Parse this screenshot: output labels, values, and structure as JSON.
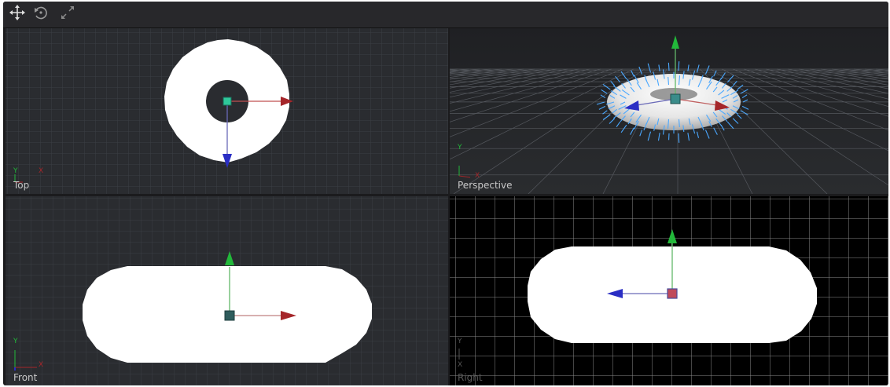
{
  "toolbar": {
    "tools": [
      {
        "name": "move-tool",
        "icon": "move-arrows-icon"
      },
      {
        "name": "rotate-tool",
        "icon": "rotate-icon"
      },
      {
        "name": "scale-tool",
        "icon": "scale-arrows-icon"
      }
    ]
  },
  "viewports": {
    "top": {
      "label": "Top",
      "axis_labels": [
        "Y",
        "X"
      ]
    },
    "perspective": {
      "label": "Perspective",
      "axis_labels": [
        "Y",
        "X"
      ]
    },
    "front": {
      "label": "Front",
      "axis_labels": [
        "Y",
        "X"
      ]
    },
    "right": {
      "label": "Right",
      "axis_labels": [
        "Y",
        "X"
      ]
    }
  },
  "colors": {
    "x_axis": "#a5262a",
    "y_axis": "#22b83a",
    "z_axis": "#2a2ec4",
    "object": "#ffffff",
    "grid_dark": "#3a3d42",
    "grid_light": "#8a8a8a",
    "normals": "#4aa8ff",
    "pivot": "#3a8c8a"
  }
}
